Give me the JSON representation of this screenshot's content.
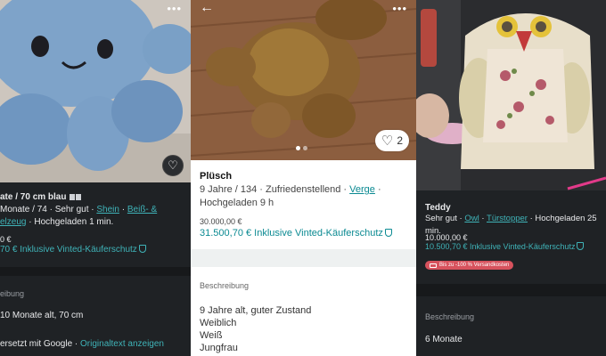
{
  "left": {
    "title": "ate / 70 cm blau",
    "meta_line1_prefix": "Monate / 74 · Sehr gut · ",
    "meta_link1": "Shein",
    "meta_sep": " · ",
    "meta_link2": "Beiß- &",
    "meta_line2_link": "elzeug",
    "meta_line2_suffix": " · Hochgeladen 1 min.",
    "price": "0 €",
    "total": "70 € Inklusive Vinted-Käuferschutz",
    "desc_label": "eibung",
    "desc_text": "10 Monate alt, 70 cm",
    "translate_text": "ersetzt mit Google · ",
    "translate_link": "Originaltext anzeigen"
  },
  "middle": {
    "title": "Plüsch",
    "meta_line1_prefix": "9 Jahre / 134 · Zufriedenstellend · ",
    "meta_link": "Verge",
    "meta_line1_suffix": " ·",
    "meta_line2": "Hochgeladen 9 h",
    "price": "30.000,00 €",
    "total": "31.500,70 € Inklusive Vinted-Käuferschutz",
    "like_count": "2",
    "desc_label": "Beschreibung",
    "desc_lines": [
      "9 Jahre alt, guter Zustand",
      "Weiblich",
      "Weiß",
      "Jungfrau"
    ]
  },
  "right": {
    "title": "Teddy",
    "meta_line1_prefix": "Sehr gut · ",
    "meta_link1": "Owl",
    "meta_sep": " · ",
    "meta_link2": "Türstopper",
    "meta_line1_suffix": " · Hochgeladen 25 min.",
    "price": "10.000,00 €",
    "total": "10.500,70 € Inklusive Vinted-Käuferschutz",
    "badge": "Bis zu -100 % Versandkosten",
    "desc_label": "Beschreibung",
    "desc_text": "6 Monate"
  },
  "icons": {
    "more": "more-options-icon",
    "back": "back-arrow-icon",
    "heart": "heart-icon",
    "shield": "shield-icon",
    "truck": "truck-icon"
  },
  "colors": {
    "accent_dark": "#3fb3b8",
    "accent_light": "#0b8a92",
    "badge": "#d7525d"
  }
}
